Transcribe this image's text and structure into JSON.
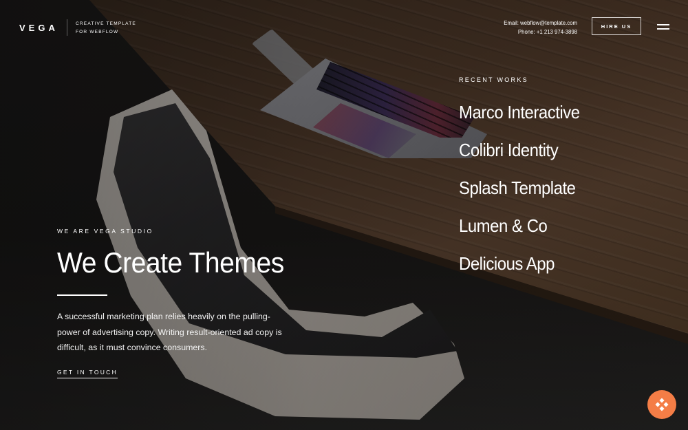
{
  "header": {
    "logo": "VEGA",
    "tagline_line1": "CREATIVE TEMPLATE",
    "tagline_line2": "FOR WEBFLOW",
    "email_label": "Email:",
    "email": "webflow@template.com",
    "phone_label": "Phone:",
    "phone": "+1 213 974-3898",
    "hire_label": "HIRE US",
    "menu_icon": "hamburger-menu-icon"
  },
  "works": {
    "label": "RECENT WORKS",
    "items": [
      "Marco Interactive",
      "Colibri Identity",
      "Splash Template",
      "Lumen & Co",
      "Delicious App"
    ]
  },
  "hero": {
    "eyebrow": "WE ARE VEGA STUDIO",
    "headline": "We Create Themes",
    "description": "A successful marketing plan relies heavily on the pulling-power of advertising copy. Writing result-oriented ad copy is difficult, as it must convince consumers.",
    "cta": "GET IN TOUCH"
  },
  "fab": {
    "icon": "webflow-diamond-icon",
    "color": "#f47d46"
  }
}
